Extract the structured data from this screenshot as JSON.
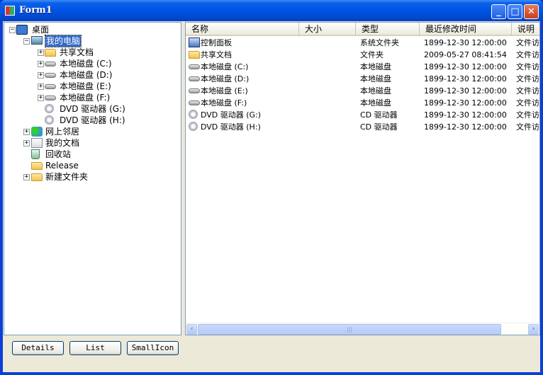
{
  "window": {
    "title": "Form1",
    "minimize": "_",
    "maximize": "□",
    "close": "✕"
  },
  "tree": [
    {
      "label": "桌面",
      "level": 0,
      "expander": "−",
      "icon": "desktop-icon",
      "cls": "desk"
    },
    {
      "label": "我的电脑",
      "level": 1,
      "expander": "−",
      "icon": "computer-icon",
      "cls": "pc",
      "selected": true
    },
    {
      "label": "共享文档",
      "level": 2,
      "expander": "+",
      "icon": "folder-icon",
      "cls": "folder"
    },
    {
      "label": "本地磁盘 (C:)",
      "level": 2,
      "expander": "+",
      "icon": "disk-icon",
      "cls": "disk"
    },
    {
      "label": "本地磁盘 (D:)",
      "level": 2,
      "expander": "+",
      "icon": "disk-icon",
      "cls": "disk"
    },
    {
      "label": "本地磁盘 (E:)",
      "level": 2,
      "expander": "+",
      "icon": "disk-icon",
      "cls": "disk"
    },
    {
      "label": "本地磁盘 (F:)",
      "level": 2,
      "expander": "+",
      "icon": "disk-icon",
      "cls": "disk"
    },
    {
      "label": "DVD 驱动器 (G:)",
      "level": 2,
      "expander": "",
      "icon": "dvd-drive-icon",
      "cls": "dvd"
    },
    {
      "label": "DVD 驱动器 (H:)",
      "level": 2,
      "expander": "",
      "icon": "dvd-drive-icon",
      "cls": "dvd"
    },
    {
      "label": "网上邻居",
      "level": 1,
      "expander": "+",
      "icon": "network-icon",
      "cls": "net"
    },
    {
      "label": "我的文档",
      "level": 1,
      "expander": "+",
      "icon": "documents-icon",
      "cls": "doc"
    },
    {
      "label": "回收站",
      "level": 1,
      "expander": "",
      "icon": "recycle-bin-icon",
      "cls": "bin"
    },
    {
      "label": "Release",
      "level": 1,
      "expander": "",
      "icon": "folder-icon",
      "cls": "folder"
    },
    {
      "label": "新建文件夹",
      "level": 1,
      "expander": "+",
      "icon": "folder-icon",
      "cls": "folder"
    }
  ],
  "list": {
    "columns": [
      "名称",
      "大小",
      "类型",
      "最近修改时间",
      "说明"
    ],
    "rows": [
      {
        "name": "控制面板",
        "size": "",
        "type": "系统文件夹",
        "modified": "1899-12-30 12:00:00",
        "desc": "文件访",
        "icon": "control-panel-icon",
        "cls": "cp"
      },
      {
        "name": "共享文档",
        "size": "",
        "type": "文件夹",
        "modified": "2009-05-27 08:41:54",
        "desc": "文件访",
        "icon": "folder-icon",
        "cls": "folder"
      },
      {
        "name": "本地磁盘 (C:)",
        "size": "",
        "type": "本地磁盘",
        "modified": "1899-12-30 12:00:00",
        "desc": "文件访",
        "icon": "disk-icon",
        "cls": "disk"
      },
      {
        "name": "本地磁盘 (D:)",
        "size": "",
        "type": "本地磁盘",
        "modified": "1899-12-30 12:00:00",
        "desc": "文件访",
        "icon": "disk-icon",
        "cls": "disk"
      },
      {
        "name": "本地磁盘 (E:)",
        "size": "",
        "type": "本地磁盘",
        "modified": "1899-12-30 12:00:00",
        "desc": "文件访",
        "icon": "disk-icon",
        "cls": "disk"
      },
      {
        "name": "本地磁盘 (F:)",
        "size": "",
        "type": "本地磁盘",
        "modified": "1899-12-30 12:00:00",
        "desc": "文件访",
        "icon": "disk-icon",
        "cls": "disk"
      },
      {
        "name": "DVD 驱动器 (G:)",
        "size": "",
        "type": "CD 驱动器",
        "modified": "1899-12-30 12:00:00",
        "desc": "文件访",
        "icon": "dvd-drive-icon",
        "cls": "dvd"
      },
      {
        "name": "DVD 驱动器 (H:)",
        "size": "",
        "type": "CD 驱动器",
        "modified": "1899-12-30 12:00:00",
        "desc": "文件访",
        "icon": "dvd-drive-icon",
        "cls": "dvd"
      }
    ]
  },
  "scrollbar": {
    "left": "‹",
    "right": "›",
    "grip": "|||"
  },
  "buttons": {
    "details": "Details",
    "list": "List",
    "smallicon": "SmallIcon"
  }
}
